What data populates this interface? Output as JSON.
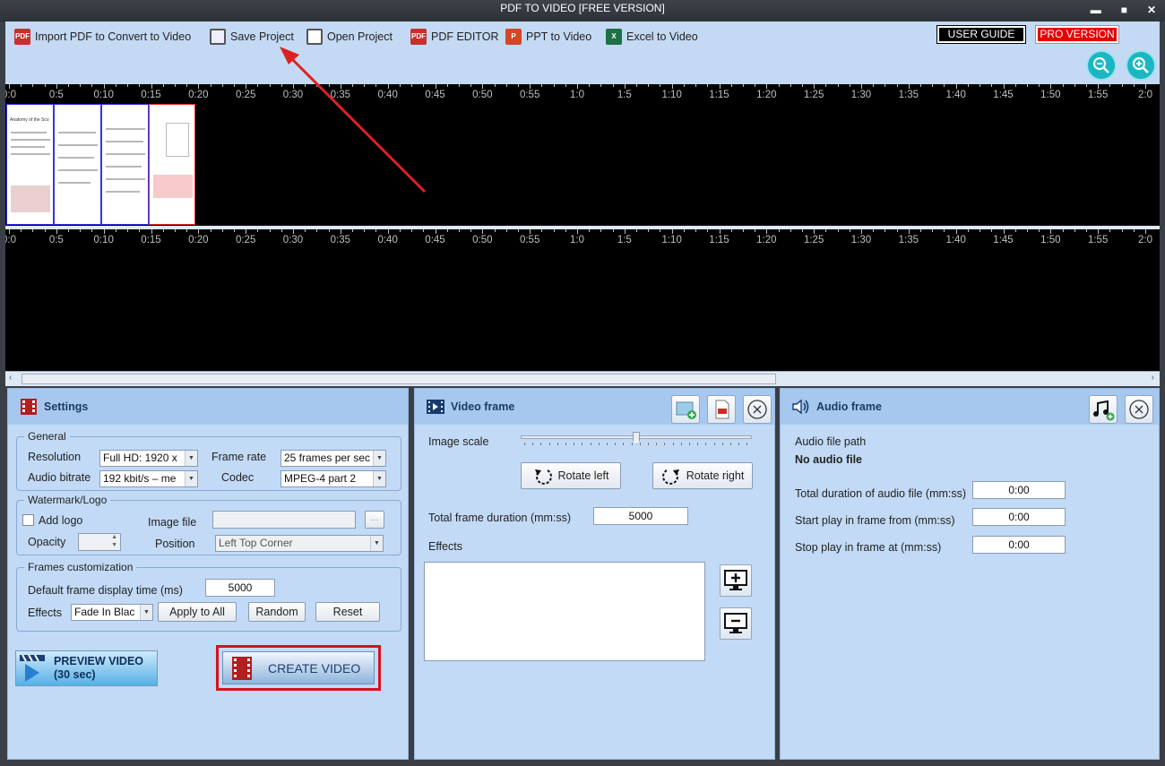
{
  "window": {
    "title": "PDF TO VIDEO [FREE VERSION]",
    "minimize": "▬",
    "maximize": "■",
    "close": "✕"
  },
  "toolbar": {
    "import_pdf": "Import PDF to Convert to Video",
    "save_project": "Save Project",
    "open_project": "Open Project",
    "pdf_editor": "PDF EDITOR",
    "ppt_to_video": "PPT to Video",
    "excel_to_video": "Excel to Video",
    "user_guide": "USER GUIDE",
    "pro_version": "PRO VERSION"
  },
  "timeline": {
    "tick_labels": [
      "0:0",
      "0:5",
      "0:10",
      "0:15",
      "0:20",
      "0:25",
      "0:30",
      "0:35",
      "0:40",
      "0:45",
      "0:50",
      "0:55",
      "1:0",
      "1:5",
      "1:10",
      "1:15",
      "1:20",
      "1:25",
      "1:30",
      "1:35",
      "1:40",
      "1:45",
      "1:50",
      "1:55",
      "2:0"
    ],
    "thumb_title": "Anatomy of the Sco"
  },
  "settings": {
    "title": "Settings",
    "general": {
      "title": "General",
      "resolution_label": "Resolution",
      "resolution_value": "Full HD: 1920 x",
      "frame_rate_label": "Frame rate",
      "frame_rate_value": "25 frames per sec",
      "audio_bitrate_label": "Audio bitrate",
      "audio_bitrate_value": "192 kbit/s – me",
      "codec_label": "Codec",
      "codec_value": "MPEG-4 part 2"
    },
    "watermark": {
      "title": "Watermark/Logo",
      "add_logo": "Add logo",
      "image_file_label": "Image file",
      "image_file_value": "",
      "browse": "...",
      "opacity_label": "Opacity",
      "position_label": "Position",
      "position_value": "Left Top Corner"
    },
    "frames": {
      "title": "Frames customization",
      "default_display_label": "Default frame display time (ms)",
      "default_display_value": "5000",
      "effects_label": "Effects",
      "effects_value": "Fade In Blac",
      "apply_all": "Apply to All",
      "random": "Random",
      "reset": "Reset"
    },
    "preview_line1": "PREVIEW VIDEO",
    "preview_line2": "(30 sec)",
    "create_video": "CREATE VIDEO"
  },
  "video_frame": {
    "title": "Video frame",
    "image_scale_label": "Image scale",
    "image_scale_level": 0.5,
    "rotate_left": "Rotate left",
    "rotate_right": "Rotate right",
    "total_duration_label": "Total frame duration (mm:ss)",
    "total_duration_value": "5000",
    "effects_label": "Effects"
  },
  "audio_frame": {
    "title": "Audio frame",
    "path_label": "Audio file path",
    "path_value": "No audio file",
    "total_label": "Total duration of audio file (mm:ss)",
    "total_value": "0:00",
    "start_label": "Start play in frame from (mm:ss)",
    "start_value": "0:00",
    "stop_label": "Stop play in frame at (mm:ss)",
    "stop_value": "0:00"
  },
  "colors": {
    "accent_red": "#e02020",
    "pro_red": "#e60000",
    "panel_bg": "#c2daf5",
    "zoom_teal": "#1bb6c4"
  }
}
